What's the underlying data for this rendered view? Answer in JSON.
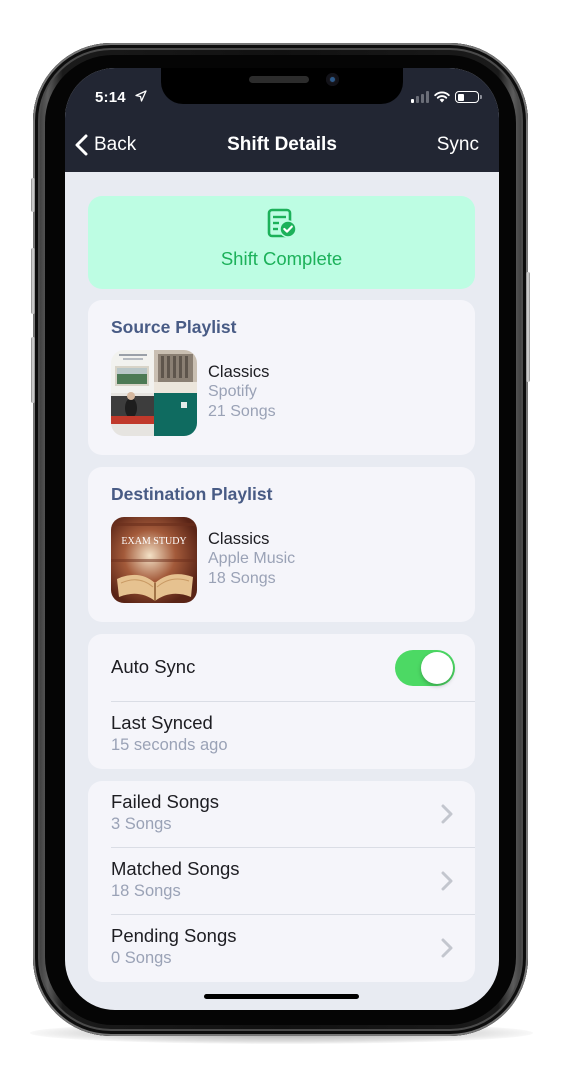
{
  "status_bar": {
    "time": "5:14",
    "location_icon": "location-arrow-icon",
    "signal_icon": "cellular-signal-icon",
    "signal_bars_active": 1,
    "signal_bars_total": 4,
    "wifi_icon": "wifi-icon",
    "battery_icon": "battery-icon",
    "battery_level": 0.35
  },
  "nav": {
    "back_icon": "chevron-left-icon",
    "back_label": "Back",
    "title": "Shift Details",
    "sync_label": "Sync"
  },
  "banner": {
    "icon": "document-check-icon",
    "label": "Shift Complete",
    "color": "#1cb15a",
    "background": "#bdfde3"
  },
  "source": {
    "title": "Source Playlist",
    "artwork": "mosaic-artwork",
    "name": "Classics",
    "service": "Spotify",
    "count": "21 Songs"
  },
  "destination": {
    "title": "Destination Playlist",
    "artwork": "exam-study-artwork",
    "artwork_text": "EXAM STUDY",
    "name": "Classics",
    "service": "Apple Music",
    "count": "18 Songs"
  },
  "sync": {
    "auto_sync_label": "Auto Sync",
    "auto_sync_on": true,
    "toggle_color": "#4cd964",
    "last_synced_label": "Last Synced",
    "last_synced_value": "15 seconds ago"
  },
  "songs": [
    {
      "label": "Failed Songs",
      "count": "3 Songs",
      "icon": "chevron-right-icon"
    },
    {
      "label": "Matched Songs",
      "count": "18 Songs",
      "icon": "chevron-right-icon"
    },
    {
      "label": "Pending Songs",
      "count": "0 Songs",
      "icon": "chevron-right-icon"
    }
  ],
  "colors": {
    "nav_background": "#222633",
    "screen_background": "#e8ebf2",
    "card_background": "#f5f5fa",
    "section_title": "#485b85",
    "secondary_text": "#9aa2b6"
  }
}
